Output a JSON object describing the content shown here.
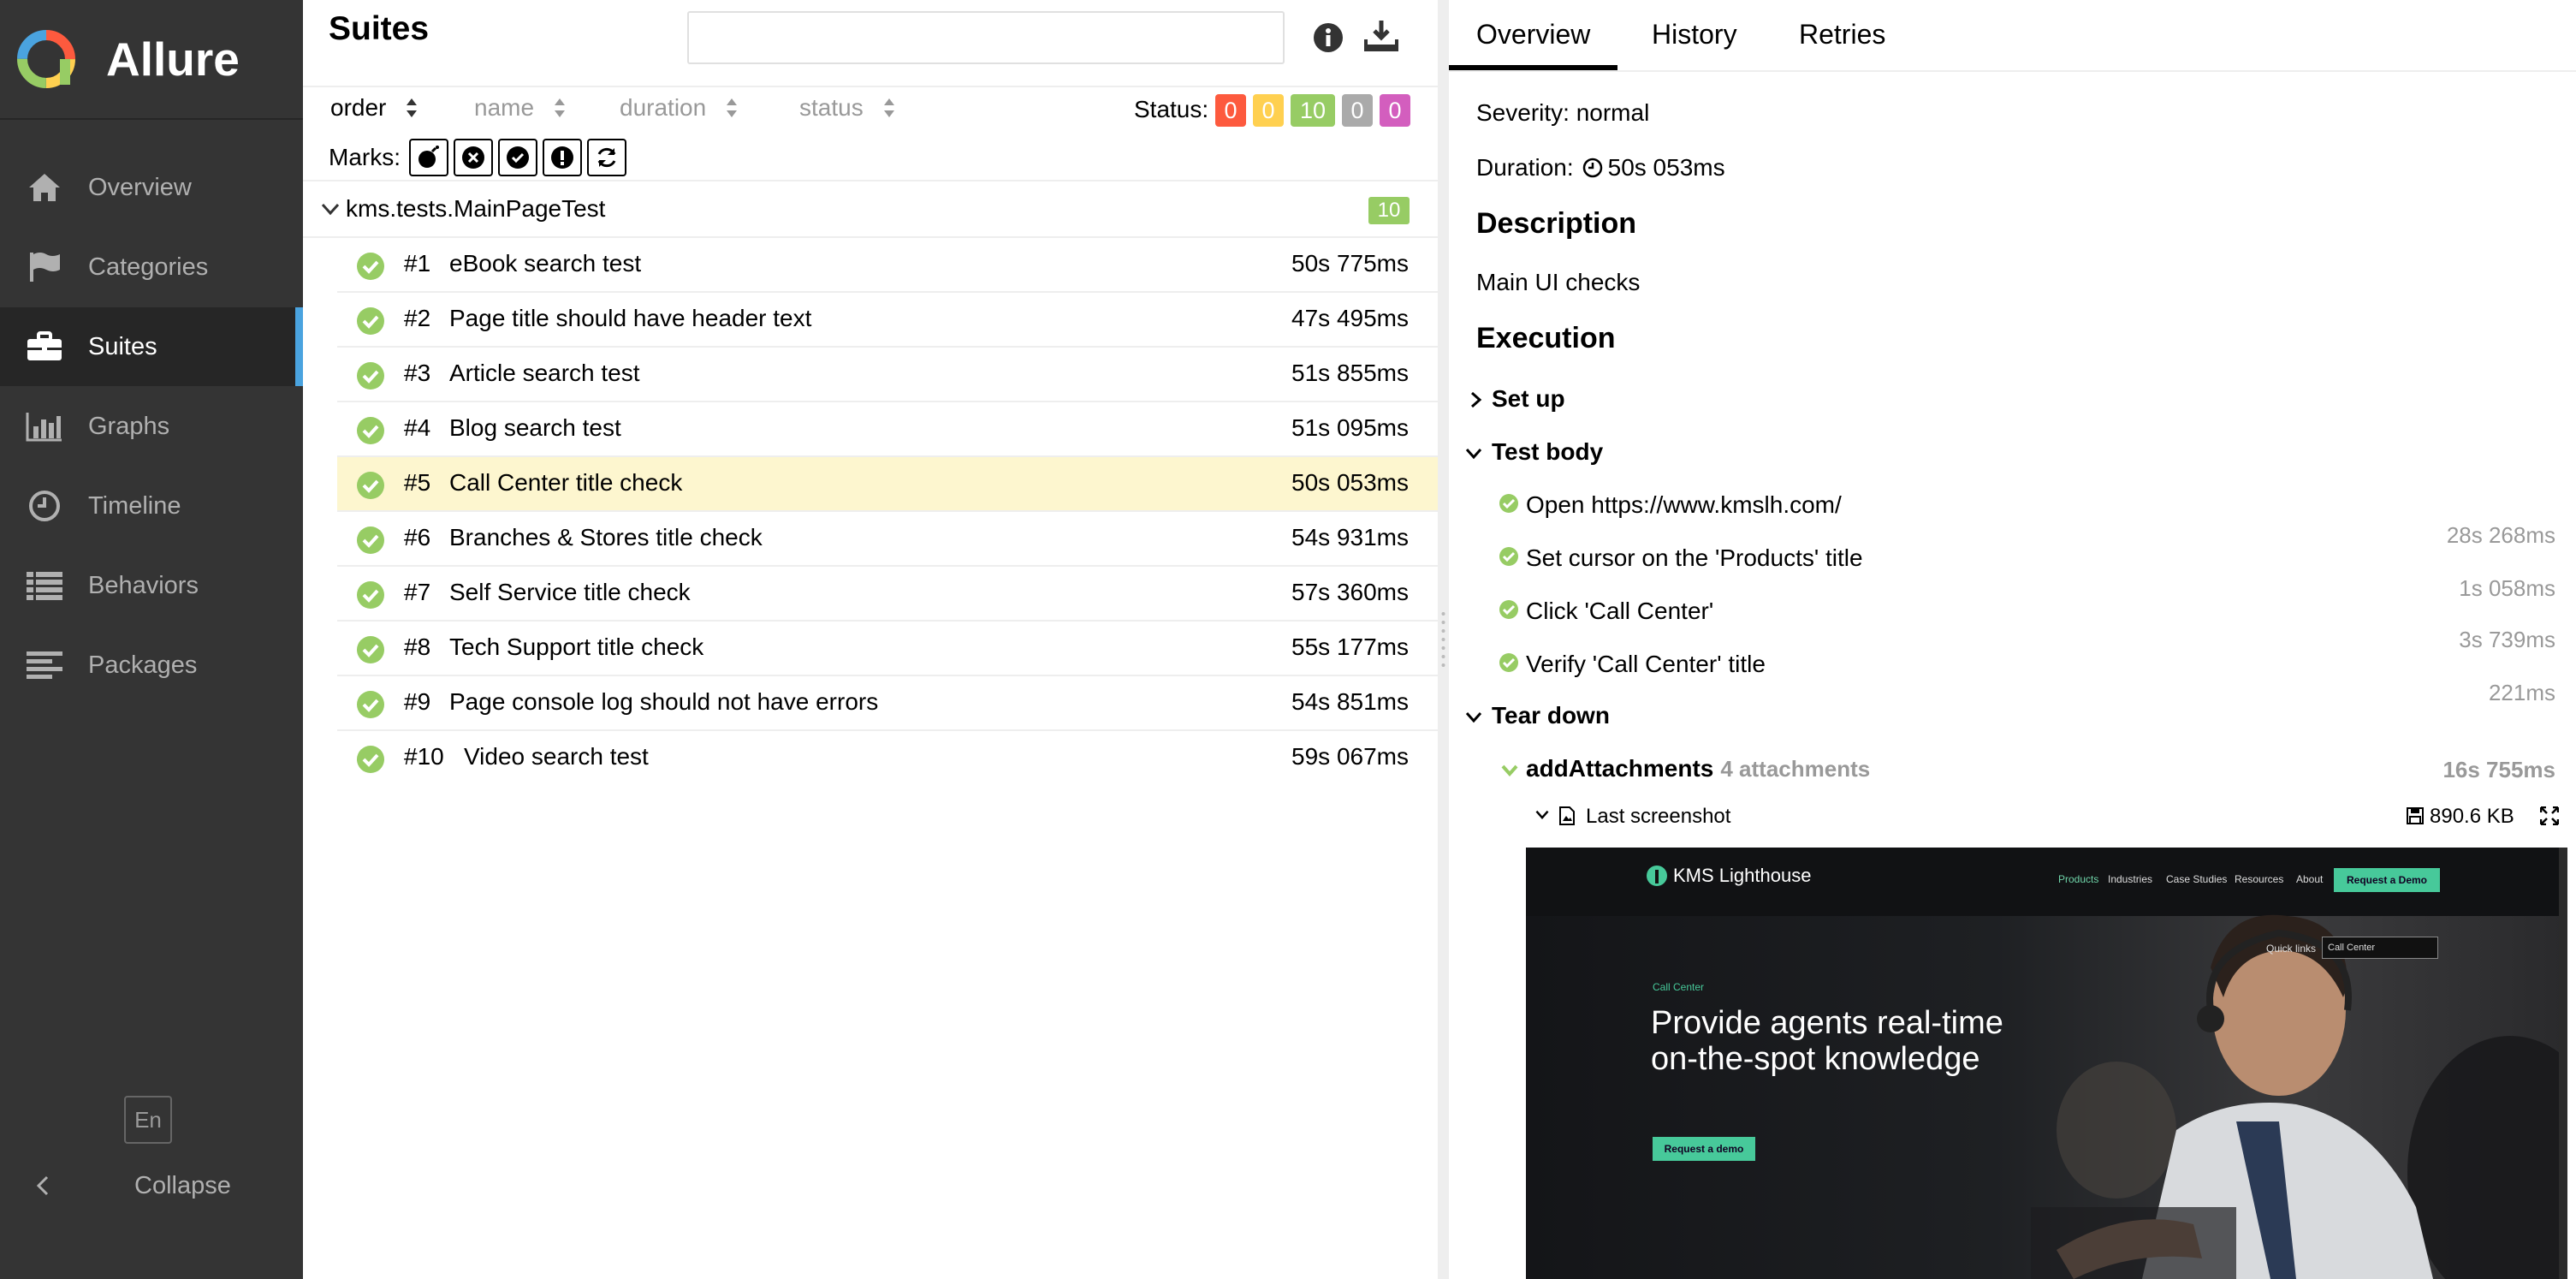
{
  "app": {
    "name": "Allure"
  },
  "sidebar": {
    "items": [
      {
        "label": "Overview",
        "icon": "home-icon",
        "active": false
      },
      {
        "label": "Categories",
        "icon": "flag-icon",
        "active": false
      },
      {
        "label": "Suites",
        "icon": "briefcase-icon",
        "active": true
      },
      {
        "label": "Graphs",
        "icon": "bar-chart-icon",
        "active": false
      },
      {
        "label": "Timeline",
        "icon": "clock-icon",
        "active": false
      },
      {
        "label": "Behaviors",
        "icon": "list-icon",
        "active": false
      },
      {
        "label": "Packages",
        "icon": "align-left-icon",
        "active": false
      }
    ],
    "language": "En",
    "collapse_label": "Collapse"
  },
  "suites": {
    "title": "Suites",
    "search_placeholder": "",
    "sort": {
      "order": "order",
      "name": "name",
      "duration": "duration",
      "status": "status"
    },
    "status_label": "Status:",
    "status_counts": [
      {
        "key": "failed",
        "value": "0",
        "color": "#fd5a3e"
      },
      {
        "key": "broken",
        "value": "0",
        "color": "#ffd050"
      },
      {
        "key": "passed",
        "value": "10",
        "color": "#97cc64"
      },
      {
        "key": "skipped",
        "value": "0",
        "color": "#aaaaaa"
      },
      {
        "key": "unknown",
        "value": "0",
        "color": "#d35ebe"
      }
    ],
    "marks_label": "Marks:",
    "group": {
      "name": "kms.tests.MainPageTest",
      "count": "10"
    },
    "tests": [
      {
        "order": "#1",
        "name": "eBook search test",
        "duration": "50s 775ms",
        "status": "passed"
      },
      {
        "order": "#2",
        "name": "Page title should have header text",
        "duration": "47s 495ms",
        "status": "passed"
      },
      {
        "order": "#3",
        "name": "Article search test",
        "duration": "51s 855ms",
        "status": "passed"
      },
      {
        "order": "#4",
        "name": "Blog search test",
        "duration": "51s 095ms",
        "status": "passed"
      },
      {
        "order": "#5",
        "name": "Call Center title check",
        "duration": "50s 053ms",
        "status": "passed",
        "selected": true
      },
      {
        "order": "#6",
        "name": "Branches & Stores title check",
        "duration": "54s 931ms",
        "status": "passed"
      },
      {
        "order": "#7",
        "name": "Self Service title check",
        "duration": "57s 360ms",
        "status": "passed"
      },
      {
        "order": "#8",
        "name": "Tech Support title check",
        "duration": "55s 177ms",
        "status": "passed"
      },
      {
        "order": "#9",
        "name": "Page console log should not have errors",
        "duration": "54s 851ms",
        "status": "passed"
      },
      {
        "order": "#10",
        "name": "Video search test",
        "duration": "59s 067ms",
        "status": "passed"
      }
    ]
  },
  "detail": {
    "tabs": [
      "Overview",
      "History",
      "Retries"
    ],
    "severity": "Severity: normal",
    "duration_label": "Duration:",
    "duration": "50s 053ms",
    "description_title": "Description",
    "description": "Main UI checks",
    "execution_title": "Execution",
    "setup_label": "Set up",
    "test_body_label": "Test body",
    "steps": [
      {
        "label": "Open https://www.kmslh.com/",
        "duration": "28s 268ms"
      },
      {
        "label": "Set cursor on the 'Products' title",
        "duration": "1s 058ms"
      },
      {
        "label": "Click 'Call Center'",
        "duration": "3s 739ms"
      },
      {
        "label": "Verify 'Call Center' title",
        "duration": "221ms"
      }
    ],
    "teardown_label": "Tear down",
    "attachments_step": {
      "label": "addAttachments",
      "count_text": "4 attachments",
      "duration": "16s 755ms"
    },
    "attachment": {
      "name": "Last screenshot",
      "size": "890.6 KB"
    }
  },
  "preview": {
    "logo": "KMS Lighthouse",
    "nav": [
      "Products",
      "Industries",
      "Case Studies",
      "Resources",
      "About"
    ],
    "demo_top": "Request a Demo",
    "quick_links_label": "Quick links",
    "quick_links_value": "Call Center",
    "section": "Call Center",
    "headline": "Provide agents real-time on-the-spot knowledge",
    "demo_button": "Request a demo"
  },
  "colors": {
    "sidebar_bg": "#343434",
    "active_indicator": "#4aa3df",
    "passed": "#97cc64",
    "selected_row": "#fdf6cf",
    "preview_accent": "#47c99a"
  }
}
